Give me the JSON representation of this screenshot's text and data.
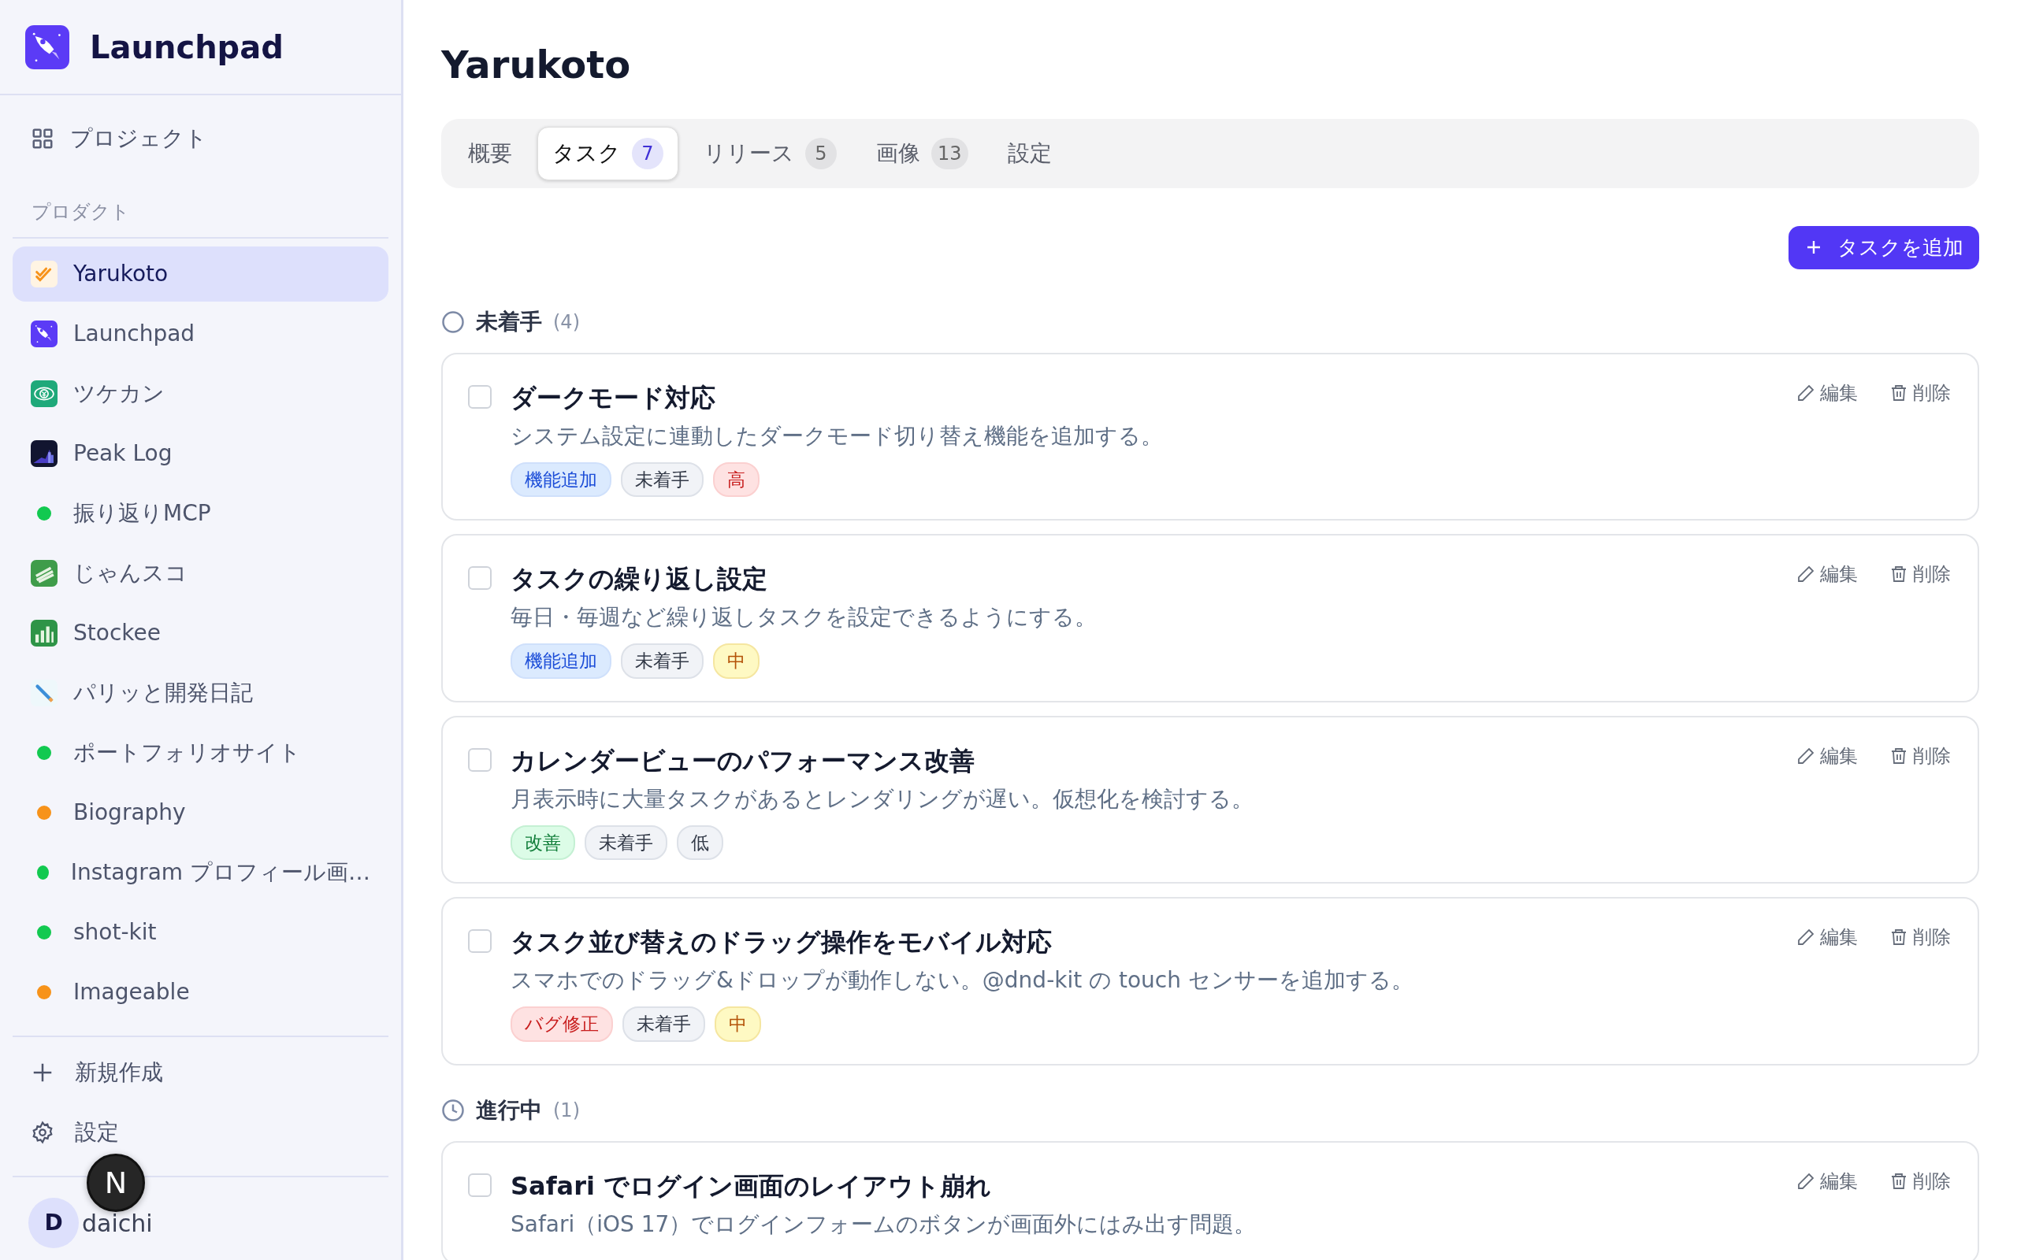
{
  "sidebar": {
    "brand": "Launchpad",
    "nav": [
      {
        "label": "プロジェクト"
      }
    ],
    "section_label": "プロダクト",
    "products": [
      {
        "name": "Yarukoto",
        "kind": "app",
        "selected": true
      },
      {
        "name": "Launchpad",
        "kind": "app",
        "selected": false
      },
      {
        "name": "ツケカン",
        "kind": "app",
        "selected": false
      },
      {
        "name": "Peak Log",
        "kind": "app",
        "selected": false
      },
      {
        "name": "振り返りMCP",
        "kind": "dot",
        "color": "#12c950",
        "selected": false
      },
      {
        "name": "じゃんスコ",
        "kind": "app",
        "selected": false
      },
      {
        "name": "Stockee",
        "kind": "app",
        "selected": false
      },
      {
        "name": "パリッと開発日記",
        "kind": "app",
        "selected": false
      },
      {
        "name": "ポートフォリオサイト",
        "kind": "dot",
        "color": "#12c950",
        "selected": false
      },
      {
        "name": "Biography",
        "kind": "dot",
        "color": "#f7931a",
        "selected": false
      },
      {
        "name": "Instagram プロフィール画…",
        "kind": "dot",
        "color": "#12c950",
        "selected": false
      },
      {
        "name": "shot-kit",
        "kind": "dot",
        "color": "#12c950",
        "selected": false
      },
      {
        "name": "Imageable",
        "kind": "dot",
        "color": "#f7931a",
        "selected": false
      }
    ],
    "footer": [
      {
        "label": "新規作成",
        "kind": "add"
      },
      {
        "label": "設定",
        "kind": "settings"
      }
    ],
    "user": {
      "initial": "D",
      "name": "daichi"
    },
    "dev_indicator": "N"
  },
  "main": {
    "title": "Yarukoto",
    "tabs": [
      {
        "label": "概要",
        "selected": false
      },
      {
        "label": "タスク",
        "count": "7",
        "selected": true
      },
      {
        "label": "リリース",
        "count": "5",
        "selected": false
      },
      {
        "label": "画像",
        "count": "13",
        "selected": false
      },
      {
        "label": "設定",
        "selected": false
      }
    ],
    "add_button": "タスクを追加",
    "groups": [
      {
        "status": "未着手",
        "count": "(4)",
        "kind": "todo",
        "tasks": [
          {
            "title": "ダークモード対応",
            "description": "システム設定に連動したダークモード切り替え機能を追加する。",
            "checked": false,
            "tags": [
              {
                "label": "機能追加",
                "kind": "feature"
              },
              {
                "label": "未着手",
                "kind": "status"
              },
              {
                "label": "高",
                "kind": "high"
              }
            ],
            "actions": [
              "編集",
              "削除"
            ]
          },
          {
            "title": "タスクの繰り返し設定",
            "description": "毎日・毎週など繰り返しタスクを設定できるようにする。",
            "checked": false,
            "tags": [
              {
                "label": "機能追加",
                "kind": "feature"
              },
              {
                "label": "未着手",
                "kind": "status"
              },
              {
                "label": "中",
                "kind": "medium"
              }
            ],
            "actions": [
              "編集",
              "削除"
            ]
          },
          {
            "title": "カレンダービューのパフォーマンス改善",
            "description": "月表示時に大量タスクがあるとレンダリングが遅い。仮想化を検討する。",
            "checked": false,
            "tags": [
              {
                "label": "改善",
                "kind": "improvement"
              },
              {
                "label": "未着手",
                "kind": "status"
              },
              {
                "label": "低",
                "kind": "low"
              }
            ],
            "actions": [
              "編集",
              "削除"
            ]
          },
          {
            "title": "タスク並び替えのドラッグ操作をモバイル対応",
            "description": "スマホでのドラッグ&ドロップが動作しない。@dnd-kit の touch センサーを追加する。",
            "checked": false,
            "tags": [
              {
                "label": "バグ修正",
                "kind": "bug"
              },
              {
                "label": "未着手",
                "kind": "status"
              },
              {
                "label": "中",
                "kind": "medium"
              }
            ],
            "actions": [
              "編集",
              "削除"
            ]
          }
        ]
      },
      {
        "status": "進行中",
        "count": "(1)",
        "kind": "in_progress",
        "tasks": [
          {
            "title": "Safari でログイン画面のレイアウト崩れ",
            "description": "Safari（iOS 17）でログインフォームのボタンが画面外にはみ出す問題。",
            "checked": false,
            "actions": [
              "編集",
              "削除"
            ]
          }
        ]
      }
    ]
  }
}
